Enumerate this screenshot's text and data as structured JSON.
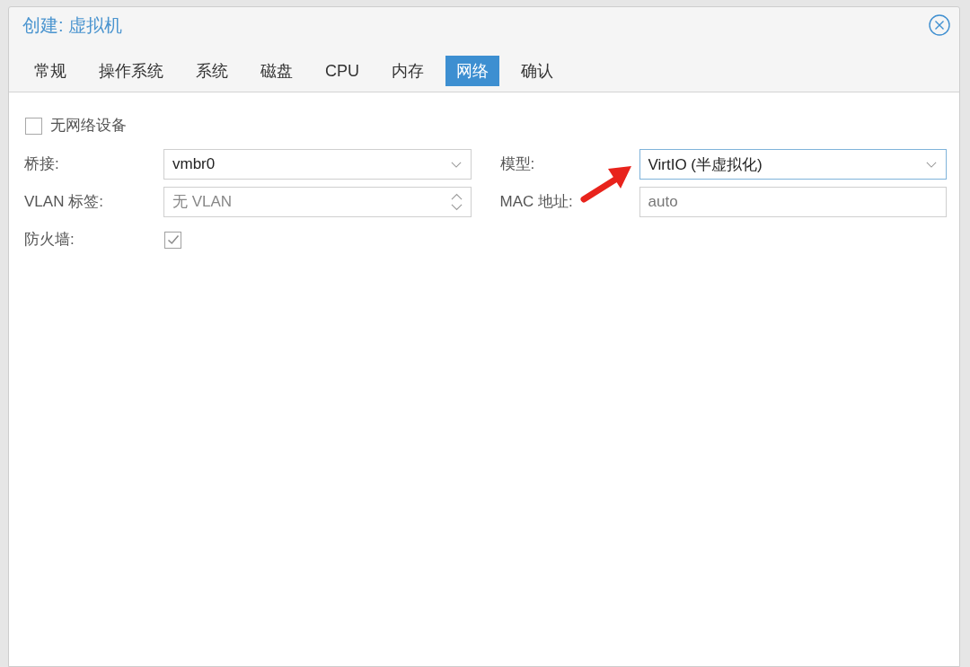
{
  "window": {
    "title": "创建: 虚拟机"
  },
  "tabs": [
    {
      "label": "常规",
      "selected": false
    },
    {
      "label": "操作系统",
      "selected": false
    },
    {
      "label": "系统",
      "selected": false
    },
    {
      "label": "磁盘",
      "selected": false
    },
    {
      "label": "CPU",
      "selected": false
    },
    {
      "label": "内存",
      "selected": false
    },
    {
      "label": "网络",
      "selected": true
    },
    {
      "label": "确认",
      "selected": false
    }
  ],
  "no_network_device": {
    "label": "无网络设备",
    "checked": false
  },
  "fields": [
    {
      "kind": "combo",
      "label": "桥接:",
      "value": "vmbr0",
      "focused": false
    },
    {
      "kind": "combo",
      "label": "模型:",
      "value": "VirtIO (半虚拟化)",
      "focused": true
    },
    {
      "kind": "spinner",
      "label": "VLAN 标签:",
      "placeholder": "无 VLAN",
      "focused": false
    },
    {
      "kind": "text",
      "label": "MAC 地址:",
      "placeholder": "auto",
      "focused": false
    },
    {
      "kind": "checkbox",
      "label": "防火墙:",
      "checked": true
    }
  ]
}
